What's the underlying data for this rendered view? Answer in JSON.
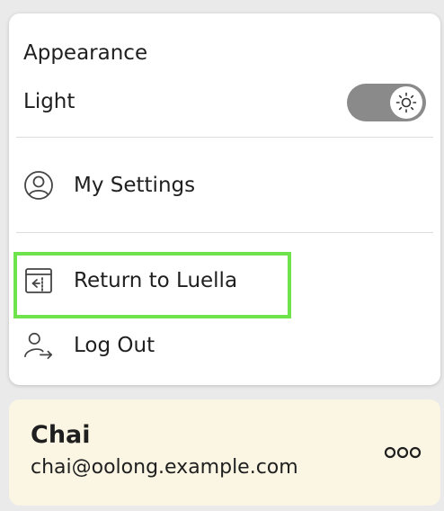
{
  "appearance": {
    "heading": "Appearance",
    "theme_label": "Light",
    "toggle_icon": "sun-icon",
    "toggle_on": true
  },
  "menu": {
    "items": [
      {
        "label": "My Settings",
        "icon": "user-circle-icon"
      },
      {
        "label": "Return to Luella",
        "icon": "return-panel-icon"
      },
      {
        "label": "Log Out",
        "icon": "logout-icon"
      }
    ]
  },
  "user": {
    "name": "Chai",
    "email": "chai@oolong.example.com",
    "more_icon": "more-options-icon"
  },
  "colors": {
    "highlight": "#6fe34b",
    "user_card_bg": "#fbf6e3",
    "toggle_bg": "#8a8a8a"
  }
}
